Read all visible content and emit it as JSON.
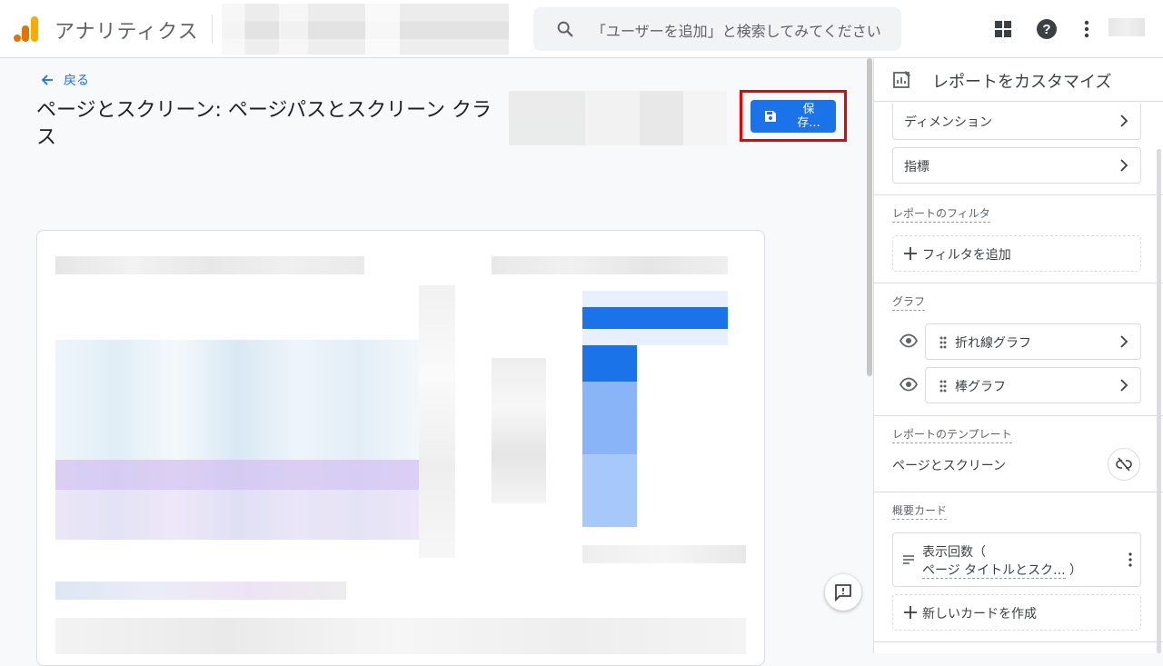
{
  "topbar": {
    "app_title": "アナリティクス",
    "search_placeholder": "「ユーザーを追加」と検索してみてください",
    "icons": [
      "apps-grid-icon",
      "help-icon",
      "more-vert-icon"
    ]
  },
  "page": {
    "back_label": "戻る",
    "title": "ページとスクリーン: ページパスとスクリーン クラス",
    "save_label": "保存..."
  },
  "panel": {
    "title": "レポートをカスタマイズ",
    "dimensions_label": "ディメンション",
    "metrics_label": "指標",
    "filter_section": "レポートのフィルタ",
    "add_filter": "フィルタを追加",
    "chart_section": "グラフ",
    "line_chart": "折れ線グラフ",
    "bar_chart": "棒グラフ",
    "template_section": "レポートのテンプレート",
    "template_name": "ページとスクリーン",
    "summary_section": "概要カード",
    "summary_card_line1": "表示回数（",
    "summary_card_line2a": "ページ タイトルとスク...",
    "summary_card_line2b": "）",
    "new_card": "新しいカードを作成"
  },
  "colors": {
    "accent": "#1a73e8",
    "highlight_frame": "#ee0000",
    "logo_orange": "#f9ab00",
    "logo_dark_orange": "#e37400"
  }
}
